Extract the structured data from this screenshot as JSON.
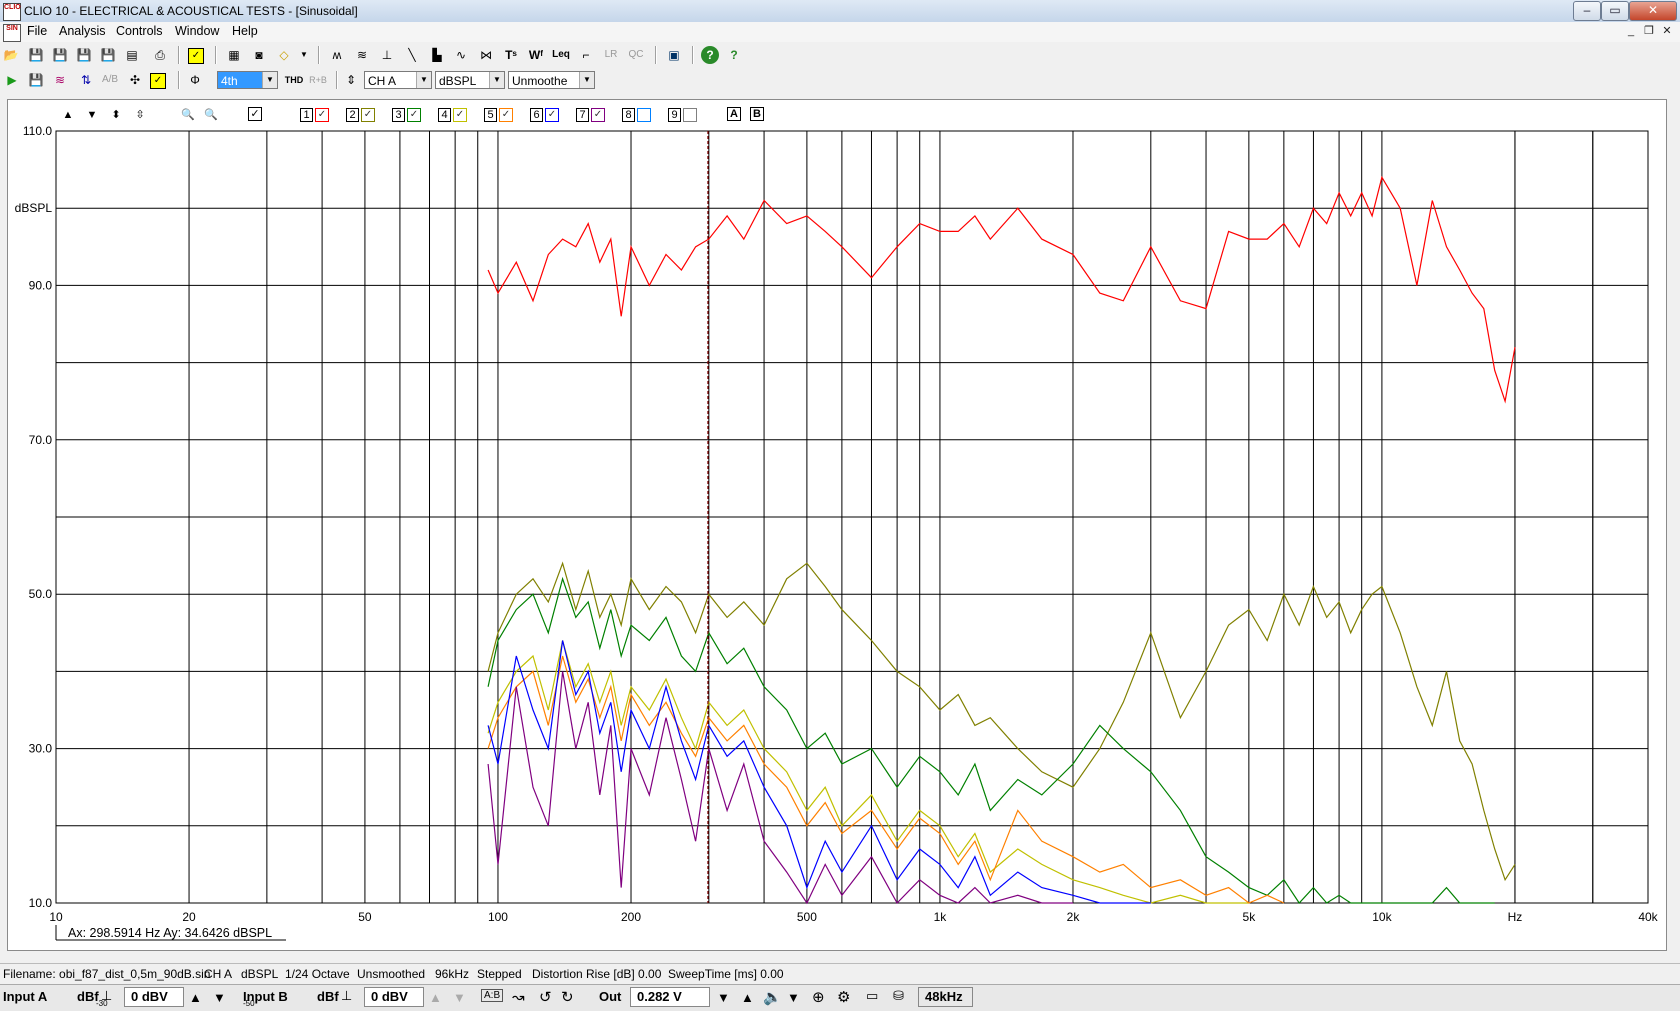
{
  "window": {
    "title": "CLIO 10 - ELECTRICAL & ACOUSTICAL TESTS - [Sinusoidal]",
    "icon_text": "CLIO",
    "buttons": [
      "minimize-icon",
      "maximize-icon",
      "close-icon"
    ]
  },
  "menu": [
    "File",
    "Analysis",
    "Controls",
    "Window",
    "Help"
  ],
  "toolbar2": {
    "harmonic": "4th",
    "thd_label": "THD",
    "rb_label": "R+B",
    "channel": "CH A",
    "unit": "dBSPL",
    "smoothing": "Unmoothe"
  },
  "graph_toolbar": {
    "trace_numbers": [
      "1",
      "2",
      "3",
      "4",
      "5",
      "6",
      "7",
      "8",
      "9"
    ],
    "trace_colors": [
      "#ff0000",
      "#808000",
      "#008000",
      "#c0c000",
      "#ff8000",
      "#0000ff",
      "#800080",
      "#0080ff",
      "#808080"
    ],
    "ab": [
      "A",
      "B"
    ]
  },
  "chart_data": {
    "type": "line",
    "x_scale": "log",
    "xlim": [
      10,
      40000
    ],
    "ylim": [
      10,
      110
    ],
    "ylabel": "dBSPL",
    "y_ticks": [
      "110.0",
      "dBSPL",
      "90.0",
      "",
      "70.0",
      "",
      "50.0",
      "",
      "30.0",
      "",
      "10.0"
    ],
    "x_tick_labels": [
      {
        "x": 10,
        "label": "10"
      },
      {
        "x": 20,
        "label": "20"
      },
      {
        "x": 50,
        "label": "50"
      },
      {
        "x": 100,
        "label": "100"
      },
      {
        "x": 200,
        "label": "200"
      },
      {
        "x": 500,
        "label": "500"
      },
      {
        "x": 1000,
        "label": "1k"
      },
      {
        "x": 2000,
        "label": "2k"
      },
      {
        "x": 5000,
        "label": "5k"
      },
      {
        "x": 10000,
        "label": "10k"
      },
      {
        "x": 20000,
        "label": "Hz"
      },
      {
        "x": 40000,
        "label": "40k"
      }
    ],
    "cursor_x": 298.5914,
    "cursor_readout": "Ax: 298.5914 Hz   Ay: 34.6426 dBSPL",
    "series": [
      {
        "color": "#ff0000",
        "x": [
          95,
          100,
          110,
          120,
          130,
          140,
          150,
          160,
          170,
          180,
          190,
          200,
          220,
          240,
          260,
          280,
          300,
          330,
          360,
          400,
          450,
          500,
          550,
          600,
          700,
          800,
          900,
          1000,
          1100,
          1200,
          1300,
          1500,
          1700,
          2000,
          2300,
          2600,
          3000,
          3500,
          4000,
          4500,
          5000,
          5500,
          6000,
          6500,
          7000,
          7500,
          8000,
          8500,
          9000,
          9500,
          10000,
          11000,
          12000,
          13000,
          14000,
          15000,
          16000,
          17000,
          18000,
          19000,
          20000
        ],
        "y": [
          92,
          89,
          93,
          88,
          94,
          96,
          95,
          98,
          93,
          96,
          86,
          95,
          90,
          94,
          92,
          95,
          96,
          99,
          96,
          101,
          98,
          99,
          97,
          95,
          91,
          95,
          98,
          97,
          97,
          99,
          96,
          100,
          96,
          94,
          89,
          88,
          95,
          88,
          87,
          97,
          96,
          96,
          98,
          95,
          100,
          98,
          102,
          99,
          102,
          99,
          104,
          100,
          90,
          101,
          95,
          92,
          89,
          87,
          79,
          75,
          82
        ]
      },
      {
        "color": "#808000",
        "x": [
          95,
          100,
          110,
          120,
          130,
          140,
          150,
          160,
          170,
          180,
          190,
          200,
          220,
          240,
          260,
          280,
          300,
          330,
          360,
          400,
          450,
          500,
          550,
          600,
          700,
          800,
          900,
          1000,
          1100,
          1200,
          1300,
          1500,
          1700,
          2000,
          2300,
          2600,
          3000,
          3500,
          4000,
          4500,
          5000,
          5500,
          6000,
          6500,
          7000,
          7500,
          8000,
          8500,
          9000,
          9500,
          10000,
          11000,
          12000,
          13000,
          14000,
          15000,
          16000,
          17000,
          18000,
          19000,
          20000
        ],
        "y": [
          40,
          45,
          50,
          52,
          49,
          54,
          48,
          53,
          47,
          50,
          46,
          52,
          48,
          51,
          49,
          45,
          50,
          47,
          49,
          46,
          52,
          54,
          51,
          48,
          44,
          40,
          38,
          35,
          37,
          33,
          34,
          30,
          27,
          25,
          30,
          36,
          45,
          34,
          40,
          46,
          48,
          44,
          50,
          46,
          51,
          47,
          49,
          45,
          48,
          50,
          51,
          45,
          38,
          33,
          40,
          31,
          28,
          22,
          17,
          13,
          15
        ]
      },
      {
        "color": "#008000",
        "x": [
          95,
          100,
          110,
          120,
          130,
          140,
          150,
          160,
          170,
          180,
          190,
          200,
          220,
          240,
          260,
          280,
          300,
          330,
          360,
          400,
          450,
          500,
          550,
          600,
          700,
          800,
          900,
          1000,
          1100,
          1200,
          1300,
          1500,
          1700,
          2000,
          2300,
          2600,
          3000,
          3500,
          4000,
          4500,
          5000,
          5500,
          6000,
          6500,
          7000,
          7500,
          8000,
          8500,
          9000,
          9500,
          10000,
          11000,
          12000,
          13000,
          14000,
          15000,
          16000,
          17000,
          18000
        ],
        "y": [
          38,
          44,
          48,
          50,
          45,
          52,
          47,
          49,
          43,
          48,
          42,
          46,
          44,
          47,
          42,
          40,
          45,
          41,
          43,
          38,
          35,
          30,
          32,
          28,
          30,
          25,
          29,
          27,
          24,
          28,
          22,
          26,
          24,
          28,
          33,
          30,
          27,
          22,
          16,
          14,
          12,
          11,
          13,
          10,
          12,
          10,
          11,
          10,
          10,
          10,
          10,
          10,
          10,
          10,
          12,
          10,
          10,
          10,
          10
        ]
      },
      {
        "color": "#c0c000",
        "x": [
          95,
          100,
          110,
          120,
          130,
          140,
          150,
          160,
          170,
          180,
          190,
          200,
          220,
          240,
          260,
          280,
          300,
          330,
          360,
          400,
          450,
          500,
          550,
          600,
          700,
          800,
          900,
          1000,
          1100,
          1200,
          1300,
          1500,
          1700,
          2000,
          2300,
          2600,
          3000,
          3500,
          4000,
          4500,
          5000
        ],
        "y": [
          32,
          36,
          40,
          42,
          35,
          44,
          38,
          41,
          36,
          40,
          33,
          38,
          35,
          39,
          34,
          30,
          36,
          33,
          35,
          30,
          27,
          22,
          25,
          20,
          24,
          18,
          22,
          20,
          16,
          19,
          14,
          17,
          15,
          13,
          12,
          11,
          10,
          11,
          10,
          10,
          10
        ]
      },
      {
        "color": "#ff8000",
        "x": [
          95,
          100,
          110,
          120,
          130,
          140,
          150,
          160,
          170,
          180,
          190,
          200,
          220,
          240,
          260,
          280,
          300,
          330,
          360,
          400,
          450,
          500,
          550,
          600,
          700,
          800,
          900,
          1000,
          1100,
          1200,
          1300,
          1500,
          1700,
          2000,
          2300,
          2600,
          3000,
          3500,
          4000,
          4500,
          5000,
          5500,
          6000
        ],
        "y": [
          30,
          34,
          38,
          40,
          33,
          42,
          36,
          39,
          34,
          38,
          31,
          37,
          33,
          36,
          32,
          29,
          34,
          31,
          33,
          28,
          25,
          20,
          23,
          19,
          22,
          17,
          21,
          19,
          15,
          18,
          13,
          22,
          18,
          16,
          14,
          15,
          12,
          13,
          11,
          12,
          10,
          11,
          10
        ]
      },
      {
        "color": "#0000ff",
        "x": [
          95,
          100,
          110,
          120,
          130,
          140,
          150,
          160,
          170,
          180,
          190,
          200,
          220,
          240,
          260,
          280,
          300,
          330,
          360,
          400,
          450,
          500,
          550,
          600,
          700,
          800,
          900,
          1000,
          1100,
          1200,
          1300,
          1500,
          1700,
          2000,
          2300,
          2600,
          3000
        ],
        "y": [
          33,
          28,
          42,
          35,
          30,
          44,
          37,
          40,
          32,
          36,
          27,
          35,
          30,
          38,
          31,
          26,
          33,
          29,
          31,
          25,
          20,
          12,
          18,
          14,
          20,
          13,
          17,
          15,
          12,
          16,
          11,
          14,
          12,
          11,
          10,
          10,
          10
        ]
      },
      {
        "color": "#800080",
        "x": [
          95,
          100,
          110,
          120,
          130,
          140,
          150,
          160,
          170,
          180,
          190,
          200,
          220,
          240,
          260,
          280,
          300,
          330,
          360,
          400,
          450,
          500,
          550,
          600,
          700,
          800,
          900,
          1000,
          1100,
          1200,
          1300,
          1500,
          1700,
          2000
        ],
        "y": [
          28,
          15,
          38,
          25,
          20,
          40,
          30,
          36,
          24,
          33,
          12,
          30,
          24,
          34,
          26,
          18,
          30,
          22,
          28,
          18,
          14,
          10,
          15,
          11,
          16,
          10,
          13,
          11,
          10,
          12,
          10,
          11,
          10,
          10
        ]
      }
    ]
  },
  "status": {
    "filename": "Filename: obi_f87_dist_0,5m_90dB.sin",
    "channel": "CH A",
    "unit": "dBSPL",
    "resolution": "1/24 Octave",
    "smoothing": "Unsmoothed",
    "rate": "96kHz",
    "mode": "Stepped",
    "distortion": "Distortion Rise [dB] 0.00",
    "sweep": "SweepTime [ms] 0.00"
  },
  "bottom": {
    "input_a": "Input A",
    "dbf_a": "dBf",
    "level_a": "0 dBV",
    "input_b": "Input B",
    "dbf_b": "dBf",
    "level_b": "0 dBV",
    "out_label": "Out",
    "out_value": "0.282 V",
    "rate": "48kHz",
    "minus_a": "-30",
    "minus_b": "-50"
  }
}
